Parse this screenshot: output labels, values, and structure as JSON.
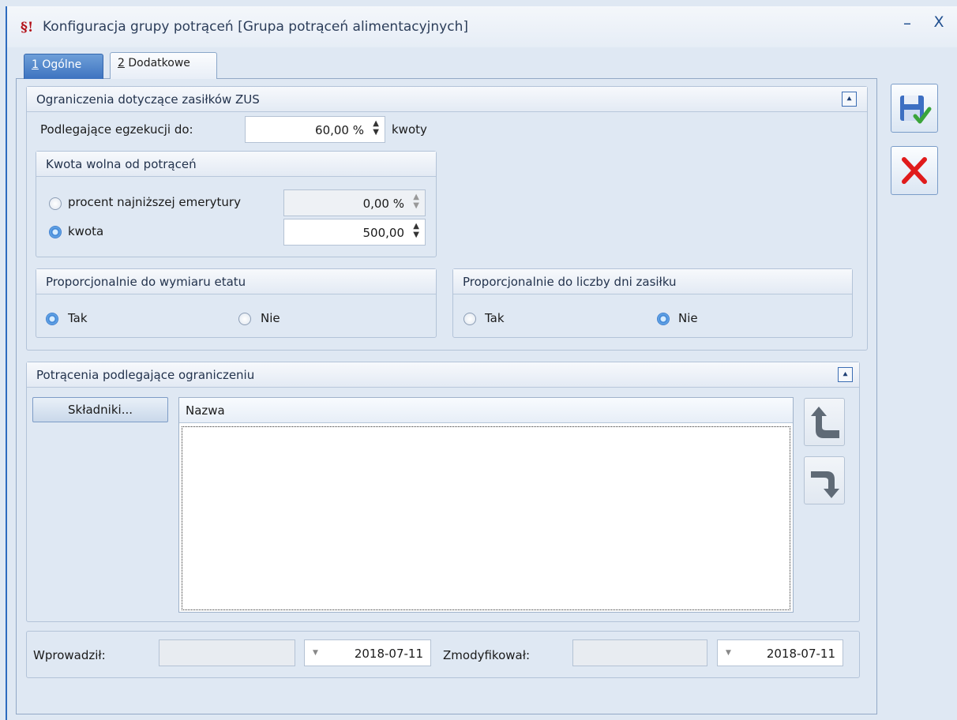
{
  "window": {
    "title": "Konfiguracja grupy potrąceń [Grupa potrąceń alimentacyjnych]",
    "app_icon": "§!",
    "minimize_glyph": "–",
    "close_glyph": "X"
  },
  "tabs": [
    {
      "key": "1",
      "label": " Ogólne",
      "active": true
    },
    {
      "key": "2",
      "label": " Dodatkowe",
      "active": false
    }
  ],
  "zus": {
    "header": "Ograniczenia dotyczące zasiłków ZUS",
    "execution_label": "Podlegające egzekucji do:",
    "execution_value": "60,00 %",
    "execution_suffix": "kwoty",
    "free_amount": {
      "header": "Kwota wolna od potrąceń",
      "option_percent_label": "procent najniższej emerytury",
      "option_percent_value": "0,00 %",
      "option_amount_label": "kwota",
      "option_amount_value": "500,00",
      "selected": "kwota"
    },
    "proportional_etat": {
      "header": "Proporcjonalnie do wymiaru etatu",
      "yes": "Tak",
      "no": "Nie",
      "selected": "Tak"
    },
    "proportional_days": {
      "header": "Proporcjonalnie do liczby dni zasiłku",
      "yes": "Tak",
      "no": "Nie",
      "selected": "Nie"
    }
  },
  "deductions": {
    "header": "Potrącenia podlegające ograniczeniu",
    "components_button": "Składniki...",
    "columns": [
      "Nazwa"
    ],
    "rows": []
  },
  "footer": {
    "entered_label": "Wprowadził:",
    "entered_by": "",
    "entered_date": "2018-07-11",
    "modified_label": "Zmodyfikował:",
    "modified_by": "",
    "modified_date": "2018-07-11"
  },
  "colors": {
    "accent": "#3d73c0",
    "save_check": "#3aa43a",
    "cancel_x": "#e01b1b"
  }
}
